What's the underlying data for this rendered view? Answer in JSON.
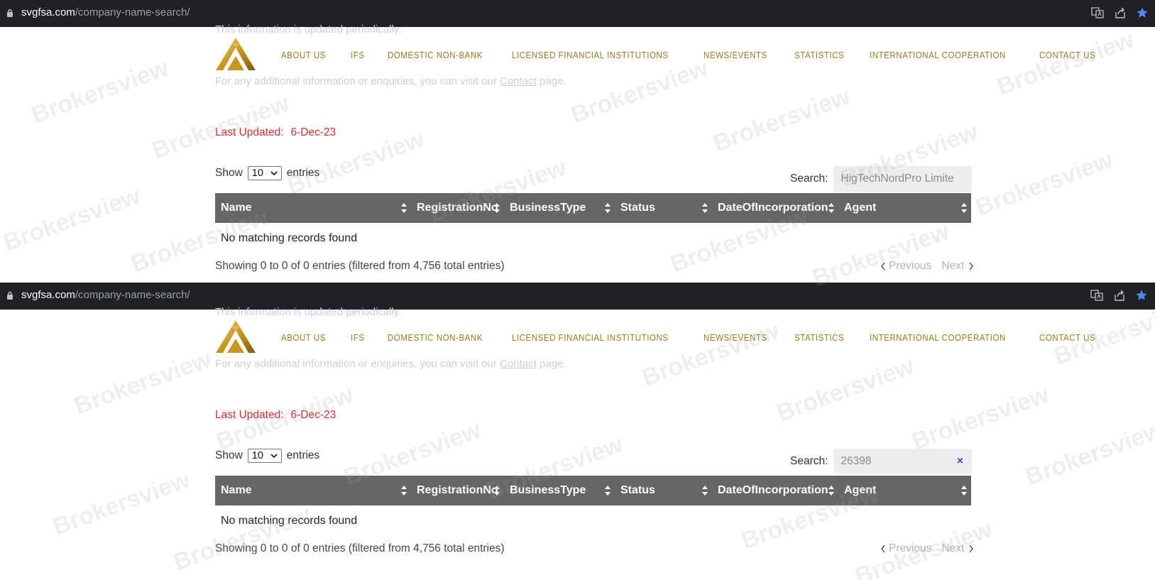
{
  "screens": [
    {
      "address_bar": {
        "host": "svgfsa.com",
        "path": "/company-name-search/"
      },
      "intro_top": "This information is updated periodically.",
      "intro_bottom_prefix": "For any additional information or enquiries, you can visit our ",
      "intro_bottom_link": "Contact",
      "intro_bottom_suffix": " page.",
      "nav": [
        "ABOUT US",
        "IFS",
        "DOMESTIC NON-BANK",
        "LICENSED FINANCIAL INSTITUTIONS",
        "NEWS/EVENTS",
        "STATISTICS",
        "INTERNATIONAL COOPERATION",
        "CONTACT US"
      ],
      "last_updated_label": "Last Updated:",
      "last_updated_value": "6-Dec-23",
      "show_label": "Show",
      "show_value": "10",
      "entries_label": "entries",
      "search_label": "Search:",
      "search_value": "HigTechNordPro Limite",
      "columns": [
        "Name",
        "RegistrationNo",
        "BusinessType",
        "Status",
        "DateOfIncorporation",
        "Agent"
      ],
      "empty_message": "No matching records found",
      "info": "Showing 0 to 0 of 0 entries (filtered from 4,756 total entries)",
      "prev_label": "Previous",
      "next_label": "Next"
    },
    {
      "address_bar": {
        "host": "svgfsa.com",
        "path": "/company-name-search/"
      },
      "intro_top": "This information is updated periodically.",
      "intro_bottom_prefix": "For any additional information or enquiries, you can visit our ",
      "intro_bottom_link": "Contact",
      "intro_bottom_suffix": " page.",
      "nav": [
        "ABOUT US",
        "IFS",
        "DOMESTIC NON-BANK",
        "LICENSED FINANCIAL INSTITUTIONS",
        "NEWS/EVENTS",
        "STATISTICS",
        "INTERNATIONAL COOPERATION",
        "CONTACT US"
      ],
      "last_updated_label": "Last Updated:",
      "last_updated_value": "6-Dec-23",
      "show_label": "Show",
      "show_value": "10",
      "entries_label": "entries",
      "search_label": "Search:",
      "search_value": "26398",
      "search_clear": "×",
      "columns": [
        "Name",
        "RegistrationNo",
        "BusinessType",
        "Status",
        "DateOfIncorporation",
        "Agent"
      ],
      "empty_message": "No matching records found",
      "info": "Showing 0 to 0 of 0 entries (filtered from 4,756 total entries)",
      "prev_label": "Previous",
      "next_label": "Next"
    }
  ],
  "watermark": "Brokersview",
  "colors": {
    "nav_gold": "#9a7b22",
    "updated_red": "#d3302f",
    "table_header": "#666666",
    "address_bar": "#202124",
    "star_blue": "#4c8bf5"
  },
  "icons": {
    "lock": "lock-icon",
    "translate": "translate-icon",
    "share": "share-icon",
    "bookmark": "star-icon",
    "sort": "sort-arrows-icon"
  }
}
